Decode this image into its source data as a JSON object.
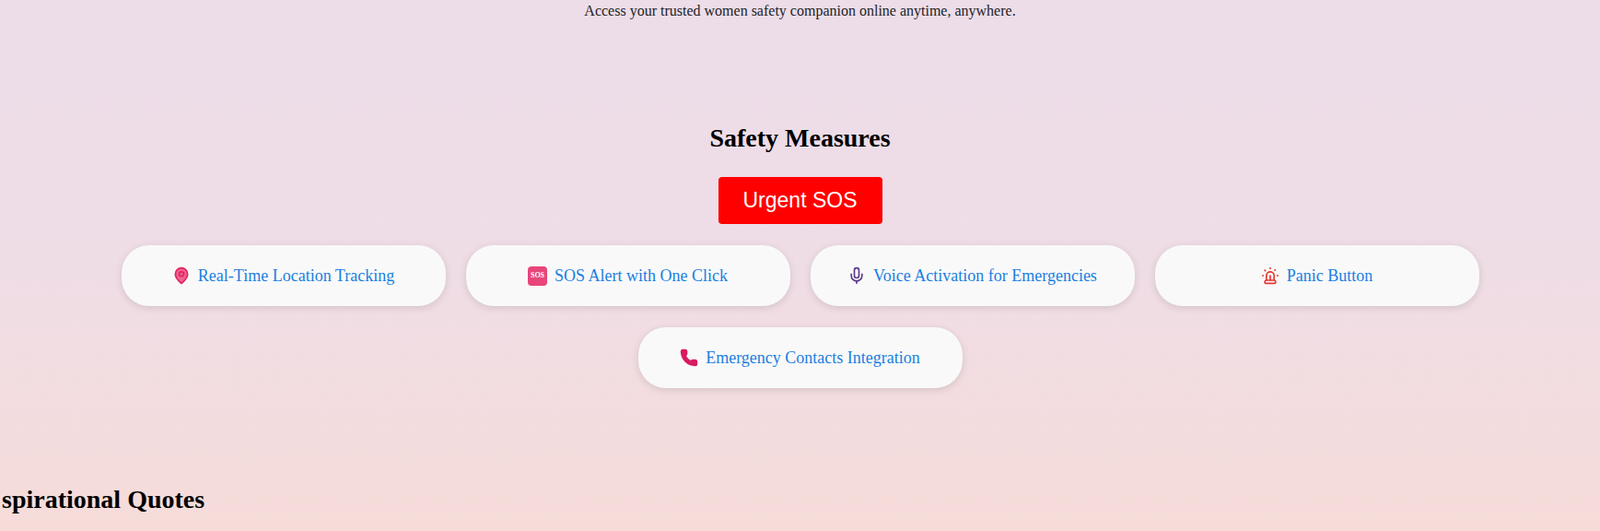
{
  "intro": "Access your trusted women safety companion online anytime, anywhere.",
  "section": {
    "title": "Safety Measures",
    "sos_button": "Urgent SOS"
  },
  "features": [
    {
      "label": "Real-Time Location Tracking"
    },
    {
      "label": "SOS Alert with One Click"
    },
    {
      "label": "Voice Activation for Emergencies"
    },
    {
      "label": "Panic Button"
    },
    {
      "label": "Emergency Contacts Integration"
    }
  ],
  "sos_badge": "SOS",
  "next_section": {
    "title": "spirational Quotes"
  }
}
